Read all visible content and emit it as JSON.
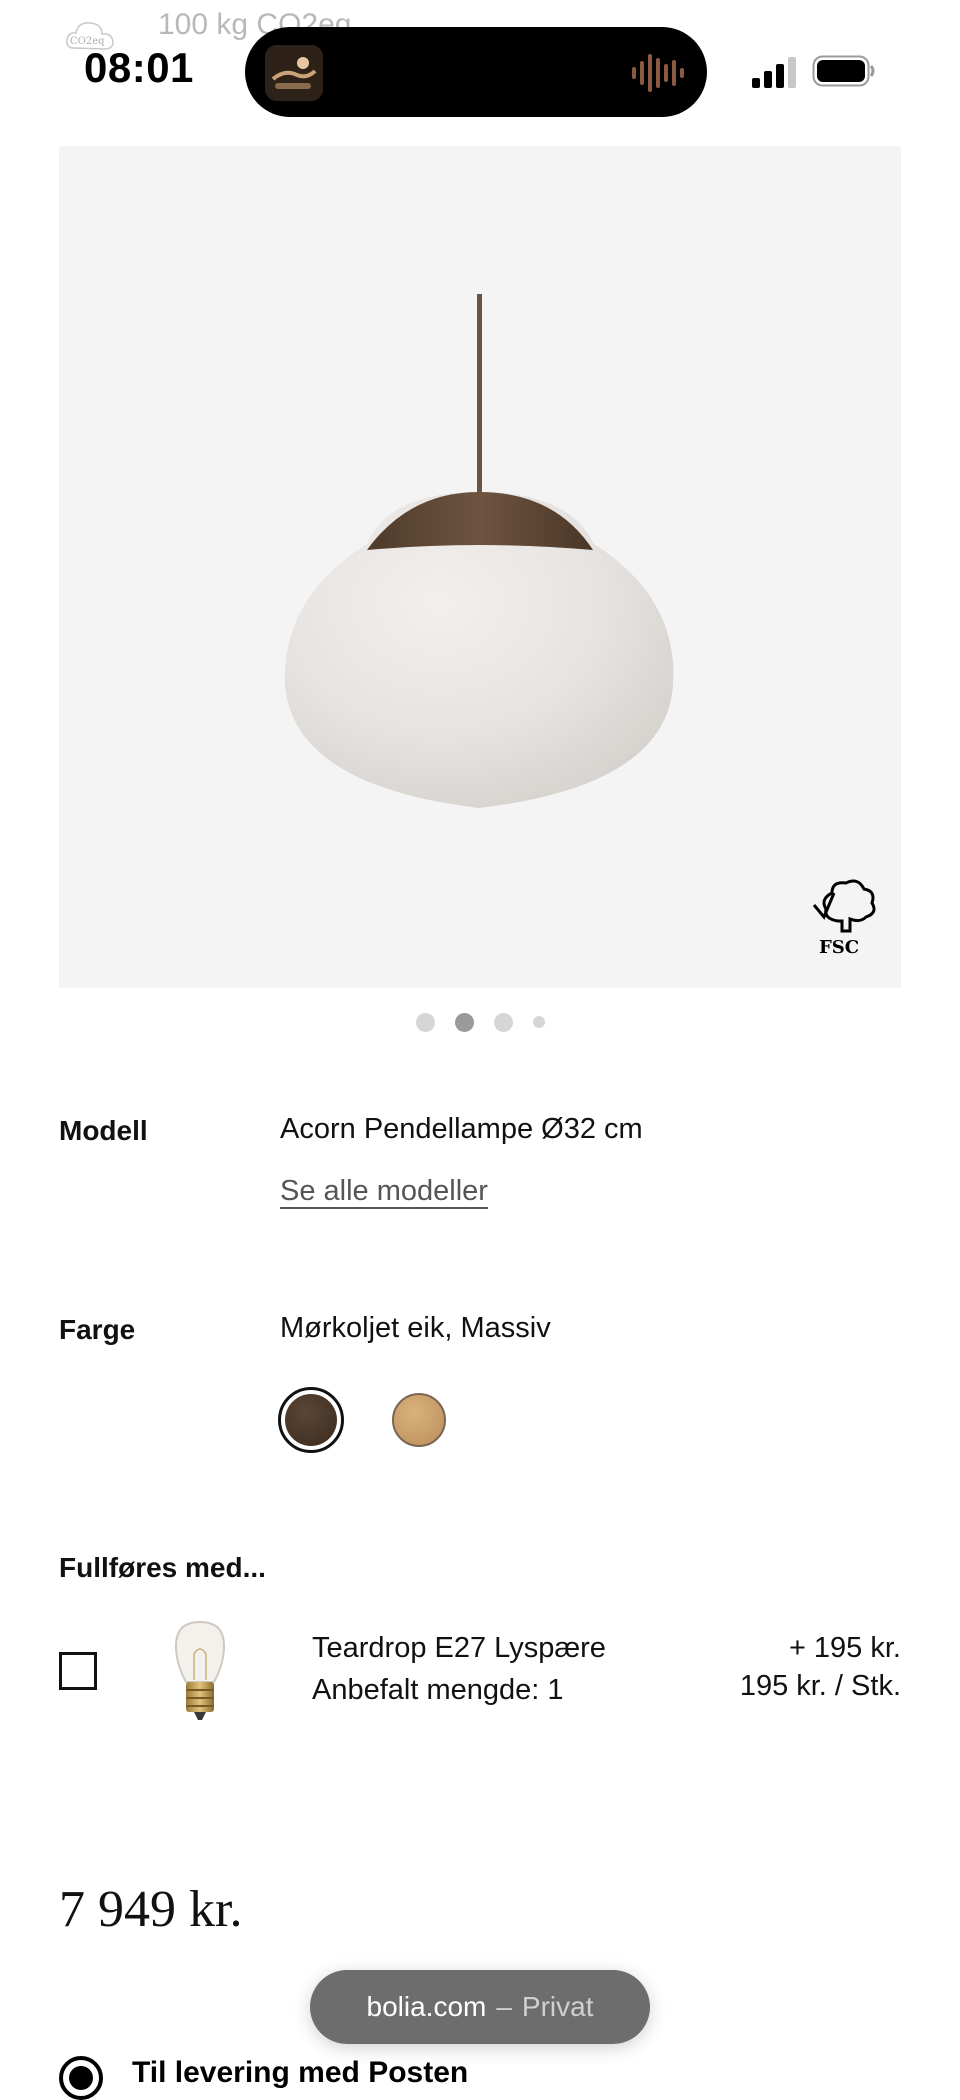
{
  "status_bar": {
    "time": "08:01",
    "co2_label": "100 kg CO2eq",
    "co2_icon_text": "CO2eq",
    "icons": [
      "co2-cloud-icon",
      "now-playing-thumbnail",
      "audio-waveform-icon",
      "cellular-signal-icon",
      "battery-icon"
    ]
  },
  "product_image": {
    "fsc_label": "FSC",
    "carousel_total": 4,
    "carousel_active_index": 1
  },
  "model": {
    "label": "Modell",
    "value": "Acorn Pendellampe Ø32 cm",
    "link": "Se alle modeller"
  },
  "color": {
    "label": "Farge",
    "value": "Mørkoljet eik, Massiv",
    "swatches": [
      {
        "name": "dark-oiled-oak",
        "hex": "#4a3828",
        "selected": true
      },
      {
        "name": "light-oak",
        "hex": "#c99a63",
        "selected": false
      }
    ]
  },
  "addon": {
    "heading": "Fullføres med...",
    "name": "Teardrop E27 Lyspære",
    "recommended": "Anbefalt mengde: 1",
    "price_add": "+ 195 kr.",
    "unit_price": "195 kr. / Stk.",
    "checked": false
  },
  "price": "7 949 kr.",
  "browser": {
    "domain": "bolia.com",
    "separator": "–",
    "mode": "Privat"
  },
  "delivery": {
    "option": "Til levering med Posten",
    "selected": true
  },
  "colors": {
    "image_bg": "#f4f4f4",
    "dot_active": "#9a9a9a",
    "dot_inactive": "#d6d6d6",
    "pill_bg": "#6d6d6d"
  }
}
